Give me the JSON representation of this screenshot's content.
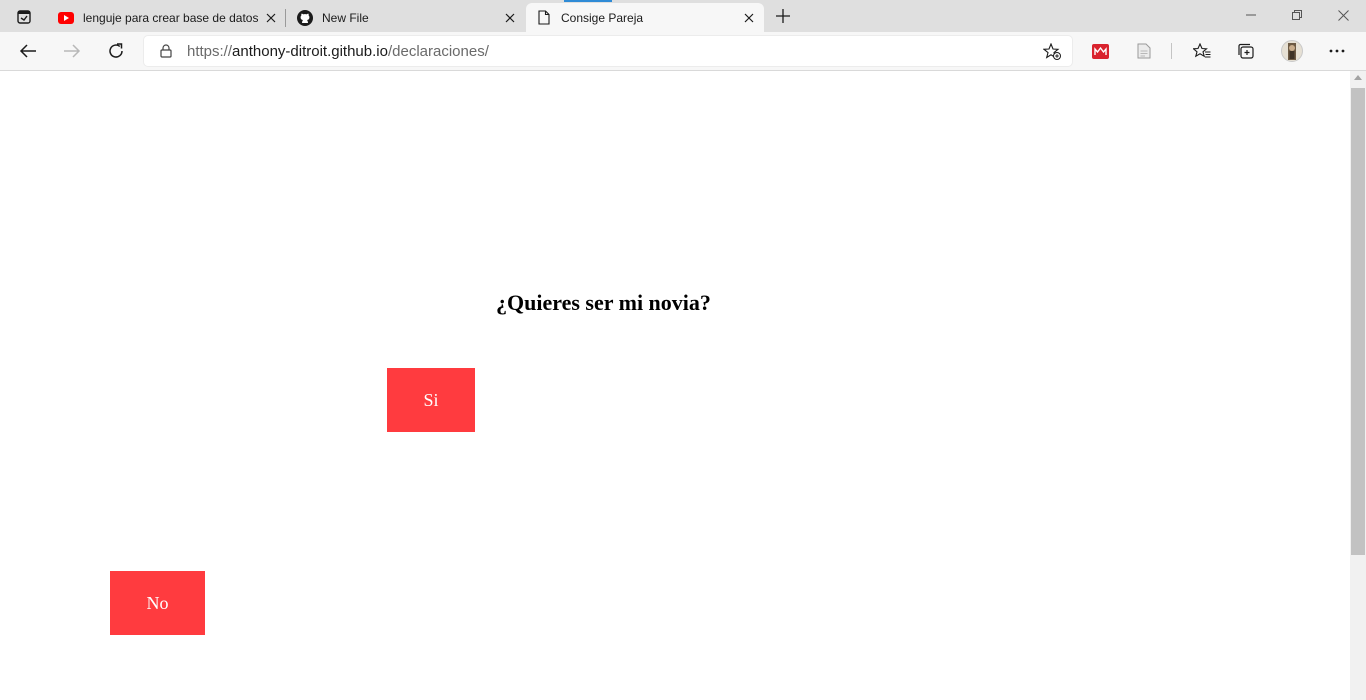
{
  "browser": {
    "tabs": [
      {
        "title": "lenguje para crear base de datos",
        "favicon": "youtube-icon",
        "active": false
      },
      {
        "title": "New File",
        "favicon": "github-icon",
        "active": false
      },
      {
        "title": "Consige Pareja",
        "favicon": "page-icon",
        "active": true
      }
    ],
    "address": {
      "scheme": "https://",
      "host": "anthony-ditroit.github.io",
      "path": "/declaraciones/"
    }
  },
  "page": {
    "question": "¿Quieres ser mi novia?",
    "yes_label": "Si",
    "no_label": "No"
  },
  "colors": {
    "button_bg": "#ff3b3f",
    "button_text": "#ffffff",
    "tab_strip": "#dfdfdf",
    "toolbar": "#f7f7f7"
  }
}
